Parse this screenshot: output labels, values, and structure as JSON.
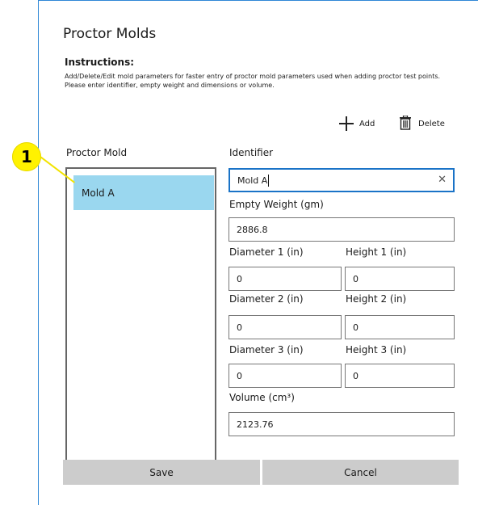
{
  "dialog": {
    "title": "Proctor Molds",
    "instructions_heading": "Instructions:",
    "instructions_text": "Add/Delete/Edit mold parameters for faster entry of proctor mold parameters used when adding proctor test points. Please enter identifier, empty weight and dimensions or volume."
  },
  "toolbar": {
    "add_label": "Add",
    "delete_label": "Delete"
  },
  "mold_list": {
    "label": "Proctor Mold",
    "items": [
      "Mold A"
    ],
    "selected_index": 0
  },
  "form": {
    "identifier": {
      "label": "Identifier",
      "value": "Mold A"
    },
    "empty_weight": {
      "label": "Empty Weight (gm)",
      "value": "2886.8"
    },
    "diameter1": {
      "label": "Diameter 1 (in)",
      "value": "0"
    },
    "height1": {
      "label": "Height 1 (in)",
      "value": "0"
    },
    "diameter2": {
      "label": "Diameter 2 (in)",
      "value": "0"
    },
    "height2": {
      "label": "Height 2 (in)",
      "value": "0"
    },
    "diameter3": {
      "label": "Diameter 3 (in)",
      "value": "0"
    },
    "height3": {
      "label": "Height 3 (in)",
      "value": "0"
    },
    "volume": {
      "label": "Volume (cm³)",
      "value": "2123.76"
    }
  },
  "buttons": {
    "save_label": "Save",
    "cancel_label": "Cancel"
  },
  "annotation": {
    "callout_number": "1",
    "callout_color": "#fff200"
  },
  "colors": {
    "accent": "#1a73c7",
    "selection": "#9ad7ef",
    "button_bg": "#cccccc"
  }
}
